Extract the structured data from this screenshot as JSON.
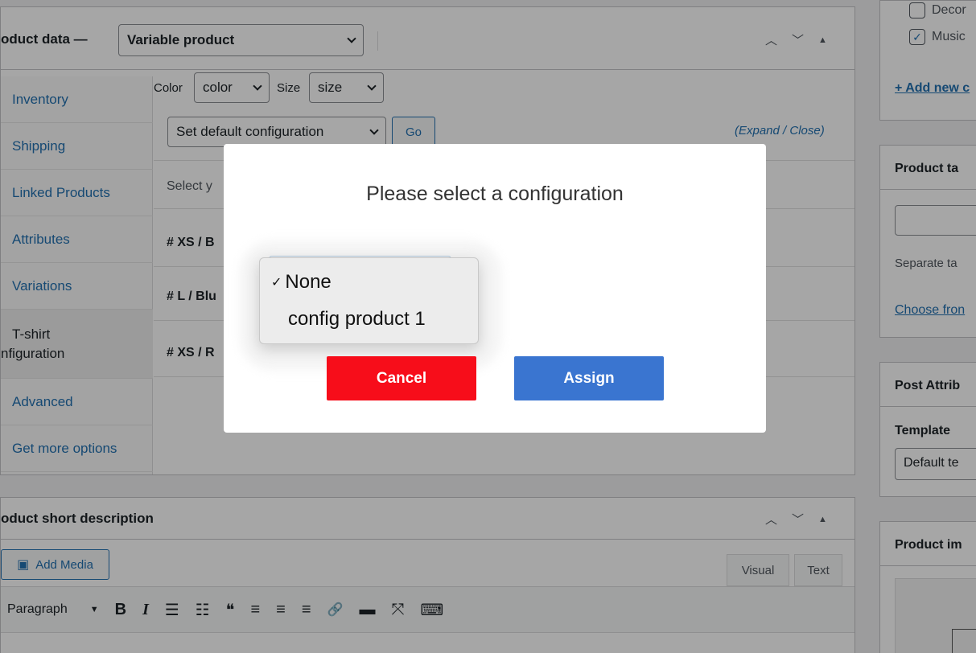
{
  "product_data": {
    "title": "oduct data —",
    "type_select": "Variable product",
    "tabs": [
      {
        "label": "Inventory"
      },
      {
        "label": "Shipping"
      },
      {
        "label": "Linked Products"
      },
      {
        "label": "Attributes"
      },
      {
        "label": "Variations"
      },
      {
        "label_line1": "T-shirt",
        "label_line2": "nfiguration"
      },
      {
        "label": "Advanced"
      },
      {
        "label": "Get more options"
      }
    ],
    "filters": {
      "color_label": "Color",
      "color_value": "color",
      "size_label": "Size",
      "size_value": "size"
    },
    "default_config_select": "Set default configuration",
    "go_label": "Go",
    "expand_label": "(Expand / Close)",
    "select_hint": "Select y",
    "variation_rows": [
      "# XS / B",
      "# L / Blu",
      "# XS / R"
    ]
  },
  "short_description": {
    "title": "oduct short description",
    "add_media_label": "Add Media",
    "tab_visual": "Visual",
    "tab_text": "Text",
    "format_select": "Paragraph",
    "toolbar_icons": [
      "bold-icon",
      "italic-icon",
      "bullet-list-icon",
      "numbered-list-icon",
      "blockquote-icon",
      "align-left-icon",
      "align-center-icon",
      "align-right-icon",
      "link-icon",
      "read-more-icon",
      "fullscreen-icon",
      "keyboard-icon"
    ],
    "toolbar_glyphs": [
      "B",
      "I",
      "☰",
      "☷",
      "❝",
      "≡",
      "≡",
      "≡",
      "🔗",
      "▬",
      "⤧",
      "⌨"
    ]
  },
  "sidebar": {
    "categories": [
      {
        "label": "Decor",
        "checked": false
      },
      {
        "label": "Music",
        "checked": true
      }
    ],
    "add_new_category": "+ Add new c",
    "product_tags_title": "Product ta",
    "tags_hint": "Separate ta",
    "choose_from": "Choose fron",
    "post_attributes_title": "Post Attrib",
    "template_label": "Template",
    "template_value": "Default te",
    "product_image_title": "Product im"
  },
  "modal": {
    "title": "Please select a configuration",
    "options": [
      {
        "label": "None",
        "selected": true
      },
      {
        "label": "config product 1",
        "selected": false
      }
    ],
    "checkmark": "✓",
    "cancel_label": "Cancel",
    "assign_label": "Assign",
    "cancel_color": "#f70d1a",
    "assign_color": "#3a75d0"
  }
}
